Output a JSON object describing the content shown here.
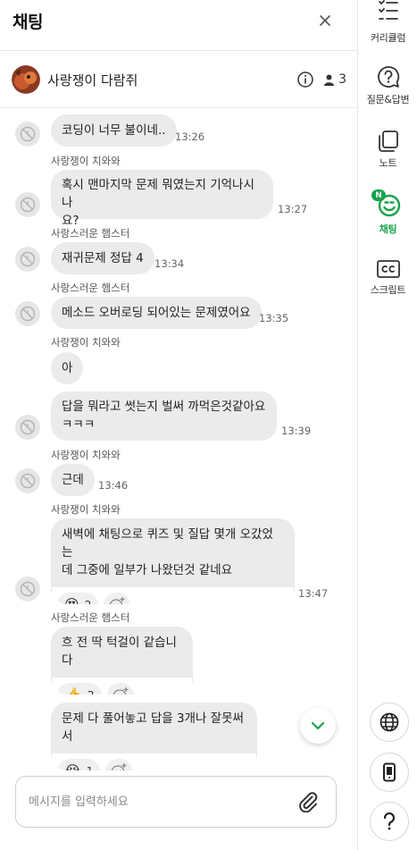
{
  "header": {
    "title": "채팅"
  },
  "room": {
    "name": "사랑쟁이 다람쥐",
    "user_count": "3"
  },
  "messages": [
    {
      "sender": "",
      "text": "코딩이 너무 불이네..",
      "time": "13:26"
    },
    {
      "sender": "사랑쟁이 치와와",
      "text_lines": [
        "혹시 맨마지막 문제 뭐였는지 기억나시나",
        "요?"
      ],
      "time": "13:27"
    },
    {
      "sender": "사랑스러운 햄스터",
      "text": "재귀문제 정답 4",
      "time": "13:34"
    },
    {
      "sender": "사랑스러운 햄스터",
      "text": "메소드 오버로딩 되어있는 문제였어요",
      "time": "13:35"
    },
    {
      "sender": "사랑쟁이 치와와",
      "text": "아",
      "time": ""
    },
    {
      "sender": "",
      "text_lines": [
        "답을 뭐라고 썻는지 벌써 까먹은것같아요",
        "ㅋㅋㅋ"
      ],
      "time": "13:39"
    },
    {
      "sender": "사랑쟁이 치와와",
      "text": "근데",
      "time": "13:46"
    },
    {
      "sender": "사랑쟁이 치와와",
      "text_lines": [
        "새벽에 채팅으로 퀴즈 및 질답 몇개 오갔었는",
        "데 그중에 일부가 나왔던것 같네요"
      ],
      "time": "13:47",
      "reaction": {
        "emoji": "😍",
        "count": "2"
      }
    },
    {
      "sender": "사랑스러운 햄스터",
      "text": "흐 전 딱 턱걸이 같습니다",
      "time": "",
      "reaction": {
        "emoji": "👍",
        "count": "2"
      }
    },
    {
      "sender": "",
      "text": "문제 다 풀어놓고 답을 3개나 잘못써서",
      "time": "",
      "reaction": {
        "emoji": "😭",
        "count": "1"
      }
    }
  ],
  "composer": {
    "placeholder": "메시지를 입력하세요"
  },
  "sidebar": {
    "items": [
      {
        "label": "커리큘럼",
        "icon": "list-icon"
      },
      {
        "label": "질문&답변",
        "icon": "question-bubble-icon"
      },
      {
        "label": "노트",
        "icon": "note-icon"
      },
      {
        "label": "채팅",
        "icon": "chat-smile-icon",
        "badge": "N",
        "active": true
      },
      {
        "label": "스크립트",
        "icon": "cc-icon"
      }
    ]
  },
  "colors": {
    "accent": "#17a34a",
    "bubble": "#ebebeb"
  }
}
